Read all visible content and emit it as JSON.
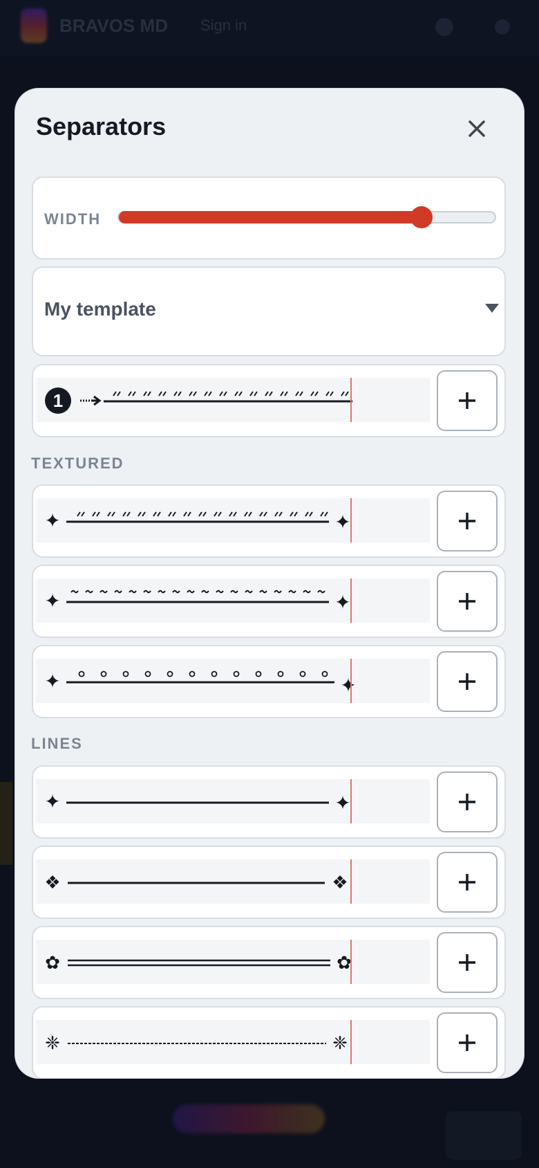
{
  "background": {
    "app_title": "BRAVOS MD",
    "app_subtitle": "Sign in"
  },
  "modal": {
    "title": "Separators",
    "close_icon": "close-icon",
    "width": {
      "label": "WIDTH",
      "value_fraction": 0.8
    },
    "template": {
      "selected": "My template"
    },
    "custom_item": {
      "icon": "numbered-circle-icon",
      "number": "1",
      "add_icon": "plus-icon"
    },
    "sections": [
      {
        "label": "TEXTURED",
        "items": [
          {
            "name": "sparkle-dotted",
            "end_glyph": "✦",
            "add_icon": "plus-icon"
          },
          {
            "name": "sparkle-tilde",
            "end_glyph": "✦",
            "add_icon": "plus-icon"
          },
          {
            "name": "sparkle-circles",
            "end_glyph": "✦",
            "add_icon": "plus-icon"
          }
        ]
      },
      {
        "label": "LINES",
        "items": [
          {
            "name": "sparkle-line",
            "end_glyph": "✦",
            "add_icon": "plus-icon"
          },
          {
            "name": "diamond-line",
            "end_glyph": "❖",
            "add_icon": "plus-icon"
          },
          {
            "name": "flower-double-line",
            "end_glyph": "✿",
            "add_icon": "plus-icon"
          },
          {
            "name": "asterisk-dashed-line",
            "end_glyph": "❈",
            "add_icon": "plus-icon"
          }
        ]
      }
    ]
  },
  "colors": {
    "accent": "#d03a26",
    "modal_bg": "#edf1f4",
    "label": "#7b8491"
  }
}
